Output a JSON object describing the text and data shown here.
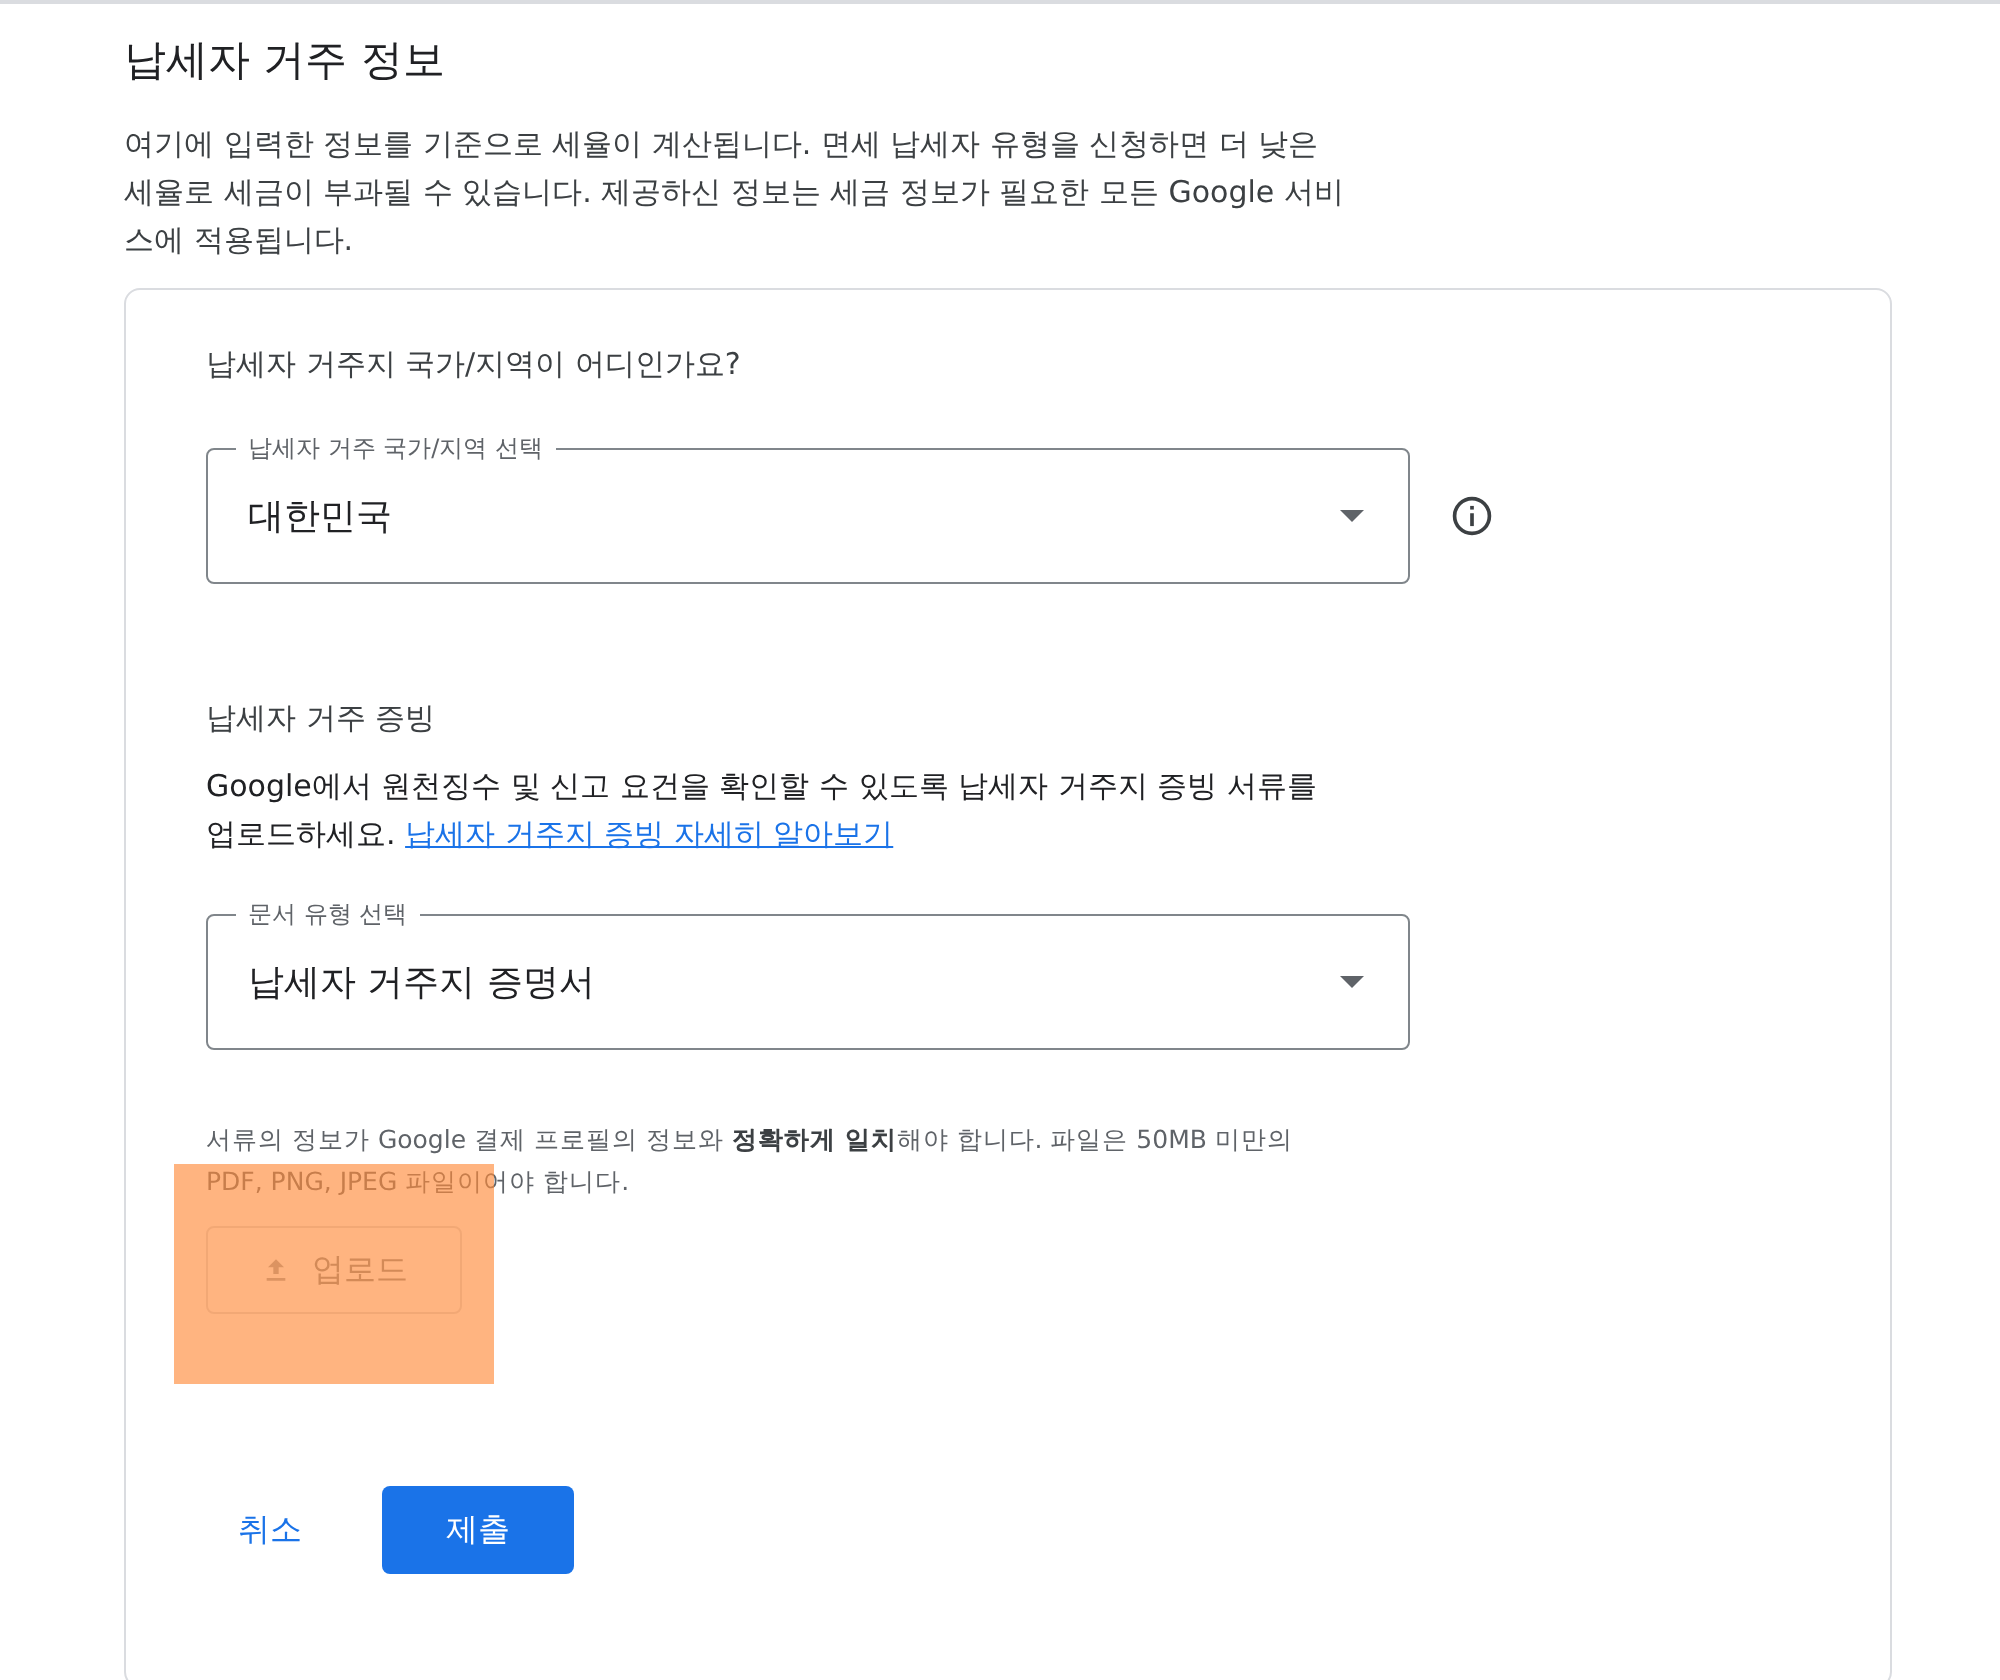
{
  "heading": "납세자 거주 정보",
  "description": "여기에 입력한 정보를 기준으로 세율이 계산됩니다. 면세 납세자 유형을 신청하면 더 낮은 세율로 세금이 부과될 수 있습니다. 제공하신 정보는 세금 정보가 필요한 모든 Google 서비스에 적용됩니다.",
  "country_question": "납세자 거주지 국가/지역이 어디인가요?",
  "country_select": {
    "label": "납세자 거주 국가/지역 선택",
    "value": "대한민국"
  },
  "proof": {
    "title": "납세자 거주 증빙",
    "text": "Google에서 원천징수 및 신고 요건을 확인할 수 있도록 납세자 거주지 증빙 서류를 업로드하세요.",
    "link": "납세자 거주지 증빙 자세히 알아보기"
  },
  "document_select": {
    "label": "문서 유형 선택",
    "value": "납세자 거주지 증명서"
  },
  "file_note": "서류의 정보가 Google 결제 프로필의 정보와 **정확하게 일치**해야 합니다. 파일은 50MB 미만의 PDF, PNG, JPEG 파일이어야 합니다.",
  "upload_button": {
    "label": "업로드",
    "disabled": true
  },
  "buttons": {
    "cancel": "취소",
    "submit": "제출"
  }
}
